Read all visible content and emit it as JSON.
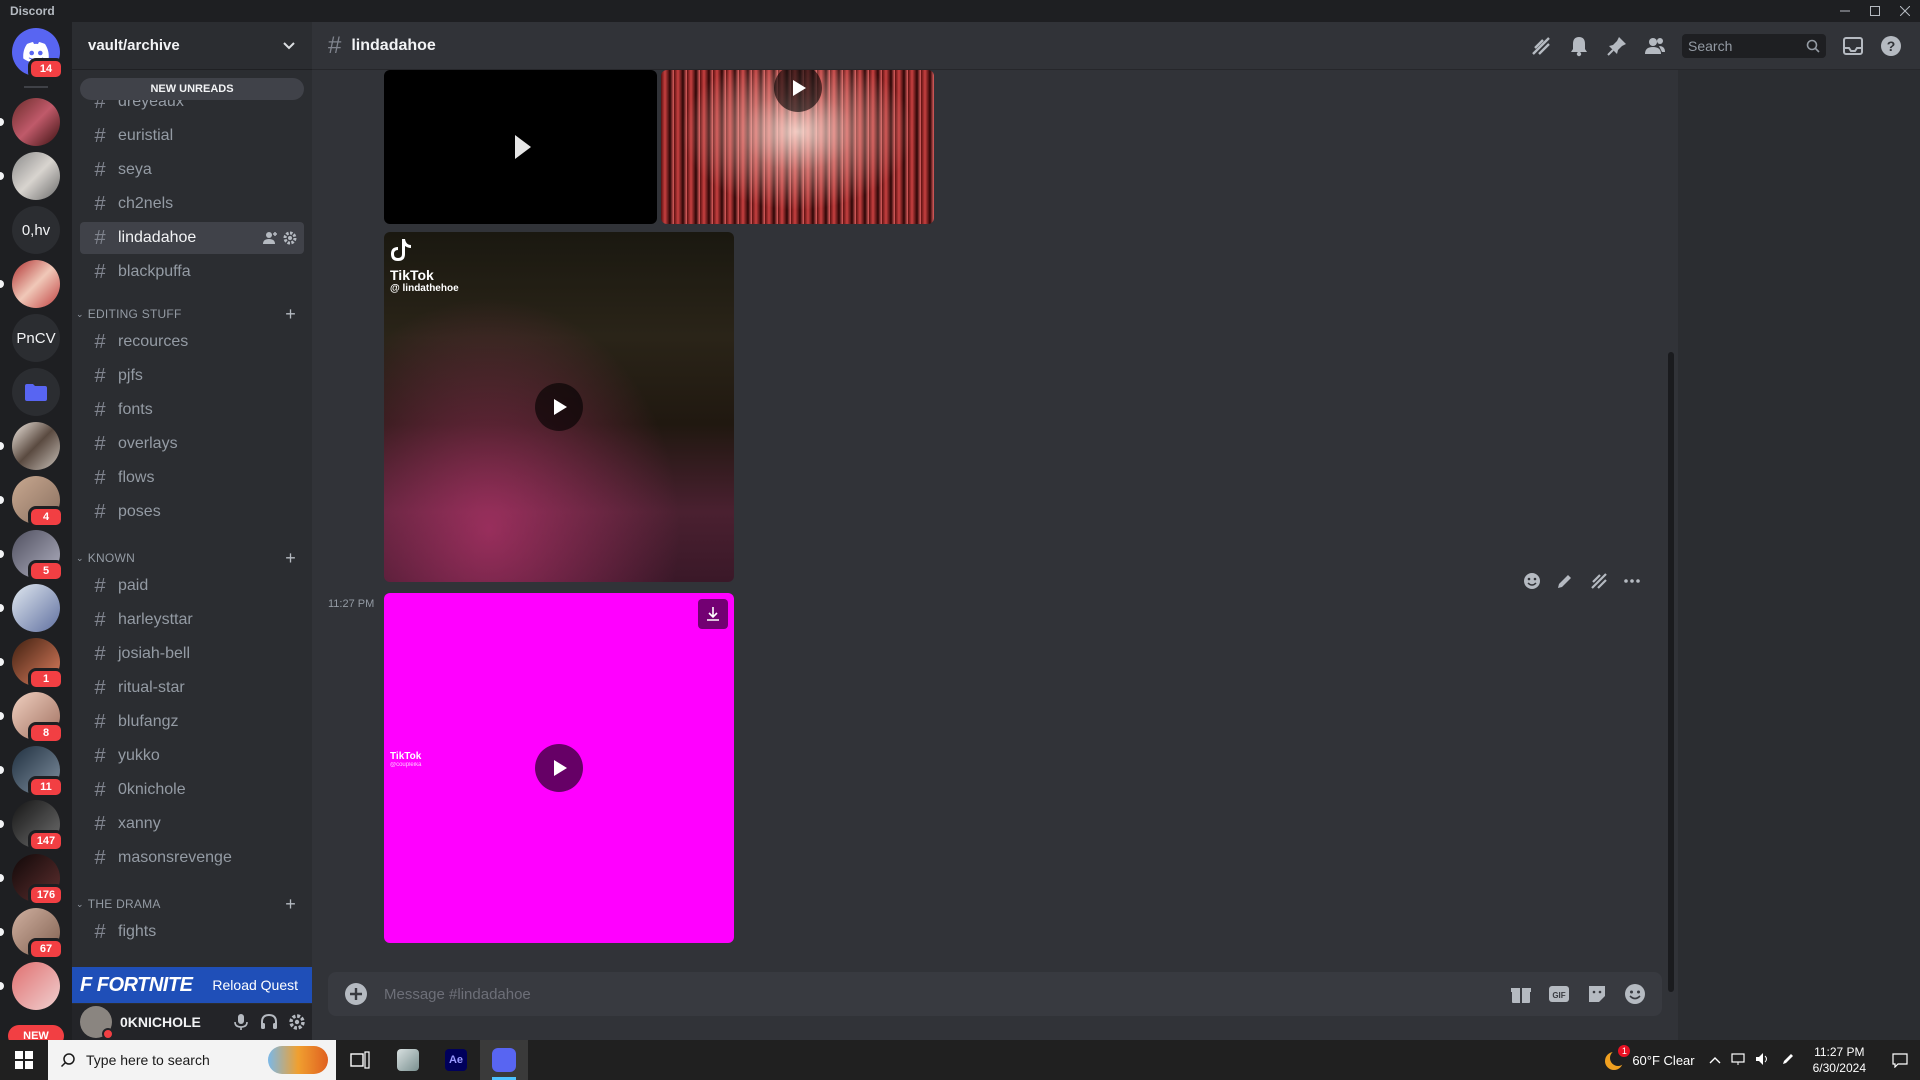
{
  "window": {
    "app_name": "Discord"
  },
  "rail": {
    "home_badge": "14",
    "text_servers": [
      {
        "label": "0,hv"
      },
      {
        "label": "PnCV"
      }
    ],
    "badges": [
      "4",
      "5",
      "1",
      "8",
      "11",
      "147",
      "176",
      "67"
    ],
    "new_label": "NEW"
  },
  "sidebar": {
    "guild_name": "vault/archive",
    "new_unreads": "NEW UNREADS",
    "top_channels": [
      "dreyeaux",
      "euristial",
      "seya",
      "ch2nels",
      "lindadahoe",
      "blackpuffa"
    ],
    "active_channel": "lindadahoe",
    "categories": [
      {
        "name": "EDITING STUFF",
        "channels": [
          "recources",
          "pjfs",
          "fonts",
          "overlays",
          "flows",
          "poses"
        ]
      },
      {
        "name": "KNOWN",
        "channels": [
          "paid",
          "harleysttar",
          "josiah-bell",
          "ritual-star",
          "blufangz",
          "yukko",
          "0knichole",
          "xanny",
          "masonsrevenge"
        ]
      },
      {
        "name": "THE DRAMA",
        "channels": [
          "fights"
        ]
      }
    ],
    "quest": {
      "logo": "F FORTNITE",
      "label": "Reload Quest"
    },
    "user": {
      "name": "0KNICHOLE"
    }
  },
  "chat": {
    "channel_name": "lindadahoe",
    "search_placeholder": "Search",
    "timestamp": "11:27 PM",
    "tiktok_1": {
      "brand": "TikTok",
      "handle": "@ lindathehoe"
    },
    "tiktok_2": {
      "brand": "TikTok",
      "handle": "@coupleika"
    },
    "composer_placeholder": "Message #lindadahoe",
    "colors": {
      "accent": "#5865f2",
      "magenta": "#ff00ff",
      "badge_red": "#f23f43"
    }
  },
  "taskbar": {
    "search_text": "Type here to search",
    "weather": "60°F  Clear",
    "weather_badge": "1",
    "time": "11:27 PM",
    "date": "6/30/2024"
  }
}
